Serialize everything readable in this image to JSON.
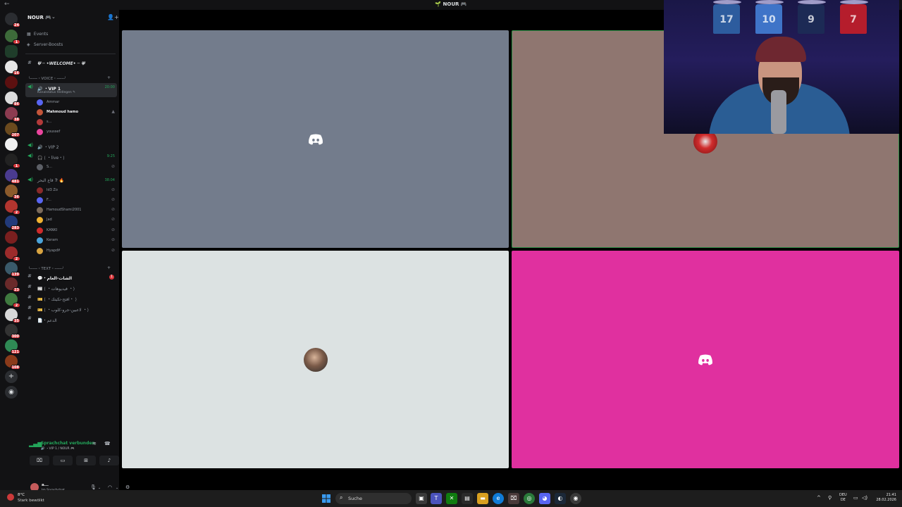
{
  "window": {
    "back_glyph": "←",
    "title": "🌱 NOUR 🎮"
  },
  "server_rail": {
    "badges": [
      "24",
      "1",
      "16",
      "86",
      "38",
      "207",
      "1",
      "481",
      "36",
      "2",
      "283",
      "2",
      "139",
      "23",
      "2",
      "35",
      "300",
      "121",
      "108"
    ]
  },
  "sidebar": {
    "guild_name": "NOUR 🎮",
    "chevron": "⌄",
    "add_user_icon": "👤+",
    "events_label": "Events",
    "boosts_label": "Server-Boosts",
    "welcome_channel": "𝚿 ─ •WELCOME• ─ 𝚿",
    "voice_category": "╰───・VOICE・───╯",
    "text_category": "╰───・TEXT・───╯",
    "vip1": {
      "name": "🔊 ・VIP 1",
      "status": "Kanalstatus festlegen ✎",
      "time": "20:00"
    },
    "vip1_users": [
      "Ammar",
      "Mahmoud hamo",
      "s...",
      "youssef"
    ],
    "vip2": {
      "name": "🔊 ・VIP 2"
    },
    "live": {
      "name": "🎧 ⟨ ・live・⟩",
      "time": "9:25"
    },
    "live_users": [
      "S..."
    ],
    "ghost": {
      "name": "𐦂 قاع البحر 🔥",
      "time": "38:04"
    },
    "ghost_users": [
      "Id3 Zo",
      "F...",
      "HamoudShami2001",
      "Jad",
      "KANKI",
      "Keram",
      "Hyapd¥"
    ],
    "text_channels": [
      {
        "name": "💬・الشات-العام",
        "unread": "1"
      },
      {
        "name": "📰 ⟨ ・فيديوهات ・⟩"
      },
      {
        "name": "🎫 ⟨ ・افتح-تكيتك・ ⟩"
      },
      {
        "name": "🎫 ⟨ ・لاعبين-جرو-كلوب ・⟩"
      },
      {
        "name": "📄・الدعم"
      }
    ],
    "voice_panel": {
      "title": "Sprachchat verbunden",
      "subtitle": "🔊 ・VIP 1 / NOUR 🎮"
    },
    "user_panel": {
      "name": "a...",
      "status": "Im Sprachchat"
    }
  },
  "stage": {
    "tiles": [
      {
        "label": "tile-user-1",
        "color": "#737c8c"
      },
      {
        "label": "tile-user-2",
        "color": "#8f7670"
      },
      {
        "label": "tile-user-3",
        "color": "#dce2e2"
      },
      {
        "label": "tile-user-4",
        "color": "#e0309f"
      }
    ]
  },
  "webcam": {
    "jerseys": [
      {
        "number": "17",
        "color": "#2d5c9e"
      },
      {
        "number": "10",
        "color": "#3f74c8"
      },
      {
        "number": "9",
        "color": "#1c2a55"
      },
      {
        "number": "7",
        "color": "#b51d2c"
      }
    ]
  },
  "taskbar": {
    "temperature": "8°C",
    "condition": "Stark bewölkt",
    "search_placeholder": "Suche",
    "lang_top": "DEU",
    "lang_bottom": "DE",
    "time": "21:41",
    "date": "28.02.2026",
    "colors": {
      "accent": "#5865f2",
      "voice_green": "#23a55a",
      "badge_red": "#da373c"
    }
  }
}
